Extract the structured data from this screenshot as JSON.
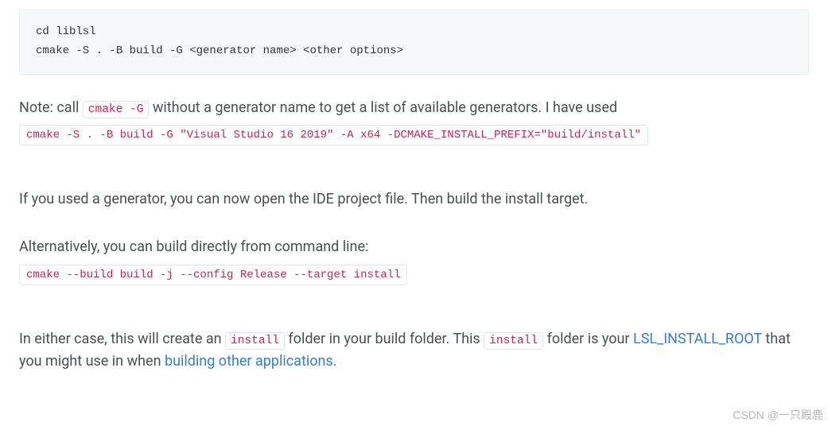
{
  "code_block_1": "cd liblsl\ncmake -S . -B build -G <generator name> <other options>",
  "para1": {
    "prefix": "Note: call ",
    "inline_code": "cmake -G",
    "suffix": " without a generator name to get a list of available generators. I have used"
  },
  "cmd1": "cmake -S . -B build -G \"Visual Studio 16 2019\" -A x64 -DCMAKE_INSTALL_PREFIX=\"build/install\"",
  "para2": "If you used a generator, you can now open the IDE project file. Then build the install target.",
  "para3": "Alternatively, you can build directly from command line:",
  "cmd2": "cmake --build build -j --config Release --target install",
  "para4": {
    "t1": "In either case, this will create an ",
    "ic1": "install",
    "t2": " folder in your build folder. This ",
    "ic2": "install",
    "t3": " folder is your ",
    "link1": "LSL_INSTALL_ROOT",
    "t4": " that you might use in when ",
    "link2": "building other applications."
  },
  "watermark": "CSDN @一只殿鹿"
}
